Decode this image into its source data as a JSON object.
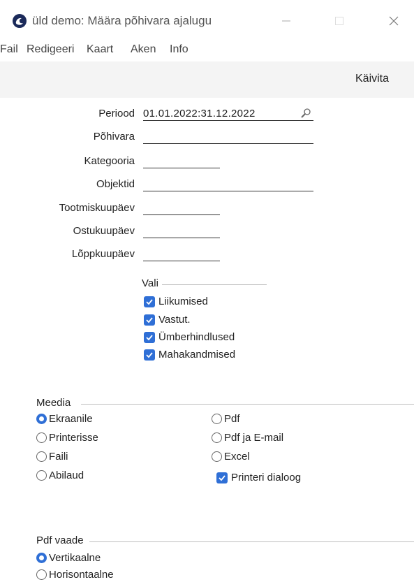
{
  "window": {
    "title": "üld demo: Määra põhivara ajalugu",
    "minimize_icon": "minimize-icon",
    "maximize_icon": "maximize-icon",
    "close_icon": "close-icon"
  },
  "menu": {
    "items": [
      "Fail",
      "Redigeeri",
      "Kaart",
      "Aken",
      "Info"
    ]
  },
  "toolbar": {
    "run_label": "Käivita"
  },
  "form": {
    "fields": [
      {
        "label": "Periood",
        "value": "01.01.2022:31.12.2022"
      },
      {
        "label": "Põhivara",
        "value": ""
      },
      {
        "label": "Kategooria",
        "value": ""
      },
      {
        "label": "Objektid",
        "value": ""
      },
      {
        "label": "Tootmiskuupäev",
        "value": ""
      },
      {
        "label": "Ostukuupäev",
        "value": ""
      },
      {
        "label": "Lõppkuupäev",
        "value": ""
      }
    ]
  },
  "vali": {
    "title": "Vali",
    "options": [
      {
        "label": "Liikumised",
        "checked": true
      },
      {
        "label": "Vastut.",
        "checked": true
      },
      {
        "label": "Ümberhindlused",
        "checked": true
      },
      {
        "label": "Mahakandmised",
        "checked": true
      }
    ]
  },
  "media": {
    "title": "Meedia",
    "left": [
      {
        "label": "Ekraanile",
        "selected": true
      },
      {
        "label": "Printerisse",
        "selected": false
      },
      {
        "label": "Faili",
        "selected": false
      },
      {
        "label": "Abilaud",
        "selected": false
      }
    ],
    "right": [
      {
        "label": "Pdf",
        "selected": false
      },
      {
        "label": "Pdf ja E-mail",
        "selected": false
      },
      {
        "label": "Excel",
        "selected": false
      }
    ],
    "printer_dialog": {
      "label": "Printeri dialoog",
      "checked": true
    }
  },
  "pdf_view": {
    "title": "Pdf vaade",
    "options": [
      {
        "label": "Vertikaalne",
        "selected": true
      },
      {
        "label": "Horisontaalne",
        "selected": false
      }
    ]
  },
  "colors": {
    "accent": "#2f6fd6",
    "toolbar_bg": "#f4f4f4"
  }
}
